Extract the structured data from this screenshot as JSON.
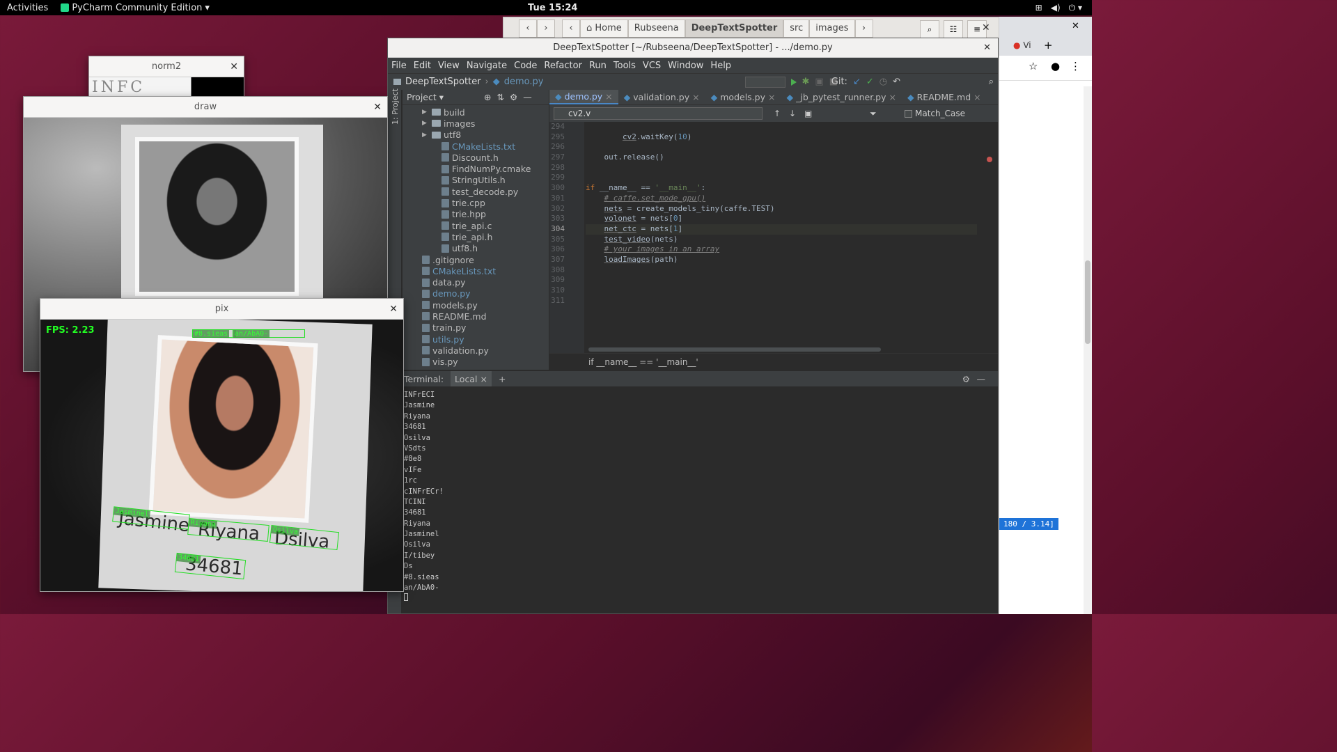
{
  "topbar": {
    "activities": "Activities",
    "app_name": "PyCharm Community Edition",
    "app_dropdown": "▾",
    "clock": "Tue 15:24"
  },
  "files": {
    "crumbs": [
      "Home",
      "Rubseena",
      "DeepTextSpotter",
      "src",
      "images"
    ],
    "active_crumb": "DeepTextSpotter"
  },
  "browser": {
    "tab_label": "Vi",
    "badge": "180 / 3.14]"
  },
  "ide": {
    "title": "DeepTextSpotter [~/Rubseena/DeepTextSpotter] - .../demo.py",
    "menu": [
      "File",
      "Edit",
      "View",
      "Navigate",
      "Code",
      "Refactor",
      "Run",
      "Tools",
      "VCS",
      "Window",
      "Help"
    ],
    "breadcrumb_project": "DeepTextSpotter",
    "breadcrumb_file": "demo.py",
    "git_label": "Git:",
    "sidebar_label": "1: Project",
    "project_header": "Project",
    "tree": [
      {
        "name": "build",
        "type": "folder",
        "indent": 2
      },
      {
        "name": "images",
        "type": "folder",
        "indent": 2
      },
      {
        "name": "utf8",
        "type": "folder",
        "indent": 2
      },
      {
        "name": "CMakeLists.txt",
        "type": "file",
        "indent": 3,
        "color": "blue"
      },
      {
        "name": "Discount.h",
        "type": "file",
        "indent": 3
      },
      {
        "name": "FindNumPy.cmake",
        "type": "file",
        "indent": 3
      },
      {
        "name": "StringUtils.h",
        "type": "file",
        "indent": 3
      },
      {
        "name": "test_decode.py",
        "type": "file",
        "indent": 3
      },
      {
        "name": "trie.cpp",
        "type": "file",
        "indent": 3
      },
      {
        "name": "trie.hpp",
        "type": "file",
        "indent": 3
      },
      {
        "name": "trie_api.c",
        "type": "file",
        "indent": 3
      },
      {
        "name": "trie_api.h",
        "type": "file",
        "indent": 3
      },
      {
        "name": "utf8.h",
        "type": "file",
        "indent": 3
      },
      {
        "name": ".gitignore",
        "type": "file",
        "indent": 1
      },
      {
        "name": "CMakeLists.txt",
        "type": "file",
        "indent": 1,
        "color": "blue"
      },
      {
        "name": "data.py",
        "type": "file",
        "indent": 1
      },
      {
        "name": "demo.py",
        "type": "file",
        "indent": 1,
        "color": "blue"
      },
      {
        "name": "models.py",
        "type": "file",
        "indent": 1
      },
      {
        "name": "README.md",
        "type": "file",
        "indent": 1
      },
      {
        "name": "train.py",
        "type": "file",
        "indent": 1
      },
      {
        "name": "utils.py",
        "type": "file",
        "indent": 1,
        "color": "blue"
      },
      {
        "name": "validation.py",
        "type": "file",
        "indent": 1
      },
      {
        "name": "vis.py",
        "type": "file",
        "indent": 1
      }
    ],
    "tabs": [
      "demo.py",
      "validation.py",
      "models.py",
      "_jb_pytest_runner.py",
      "README.md"
    ],
    "find_query": "cv2.v",
    "match_case": "Match_Case",
    "line_numbers": [
      "294",
      "295",
      "296",
      "297",
      "298",
      "299",
      "300",
      "301",
      "302",
      "303",
      "304",
      "305",
      "306",
      "307",
      "308",
      "309",
      "310",
      "311"
    ],
    "code_breadcrumb": "if __name__ == '__main__'",
    "terminal_title": "Terminal:",
    "terminal_tab": "Local",
    "terminal_output": [
      "INFrECI",
      "Jasmine",
      "Riyana",
      "34681",
      "Osilva",
      "VSdts",
      "#8e8",
      "vIFe",
      "1rc",
      "cINFrECr!",
      "TCINI",
      "34681",
      "Riyana",
      "Jasminel",
      "Osilva",
      "I/tibey",
      "Ds",
      "#8.sieas",
      "an/AbA0-"
    ]
  },
  "windows": {
    "norm2_title": "norm2",
    "norm2_text": "INFC",
    "draw_title": "draw",
    "pix_title": "pix",
    "fps": "FPS: 2.23",
    "detections": [
      "#8.sieas",
      "an/AbA0-",
      "Jasminel",
      "Riyana",
      "Osilva",
      "34681"
    ],
    "card_names": [
      "Jasmine",
      "Riyana",
      "Dsilva",
      "34681"
    ]
  }
}
